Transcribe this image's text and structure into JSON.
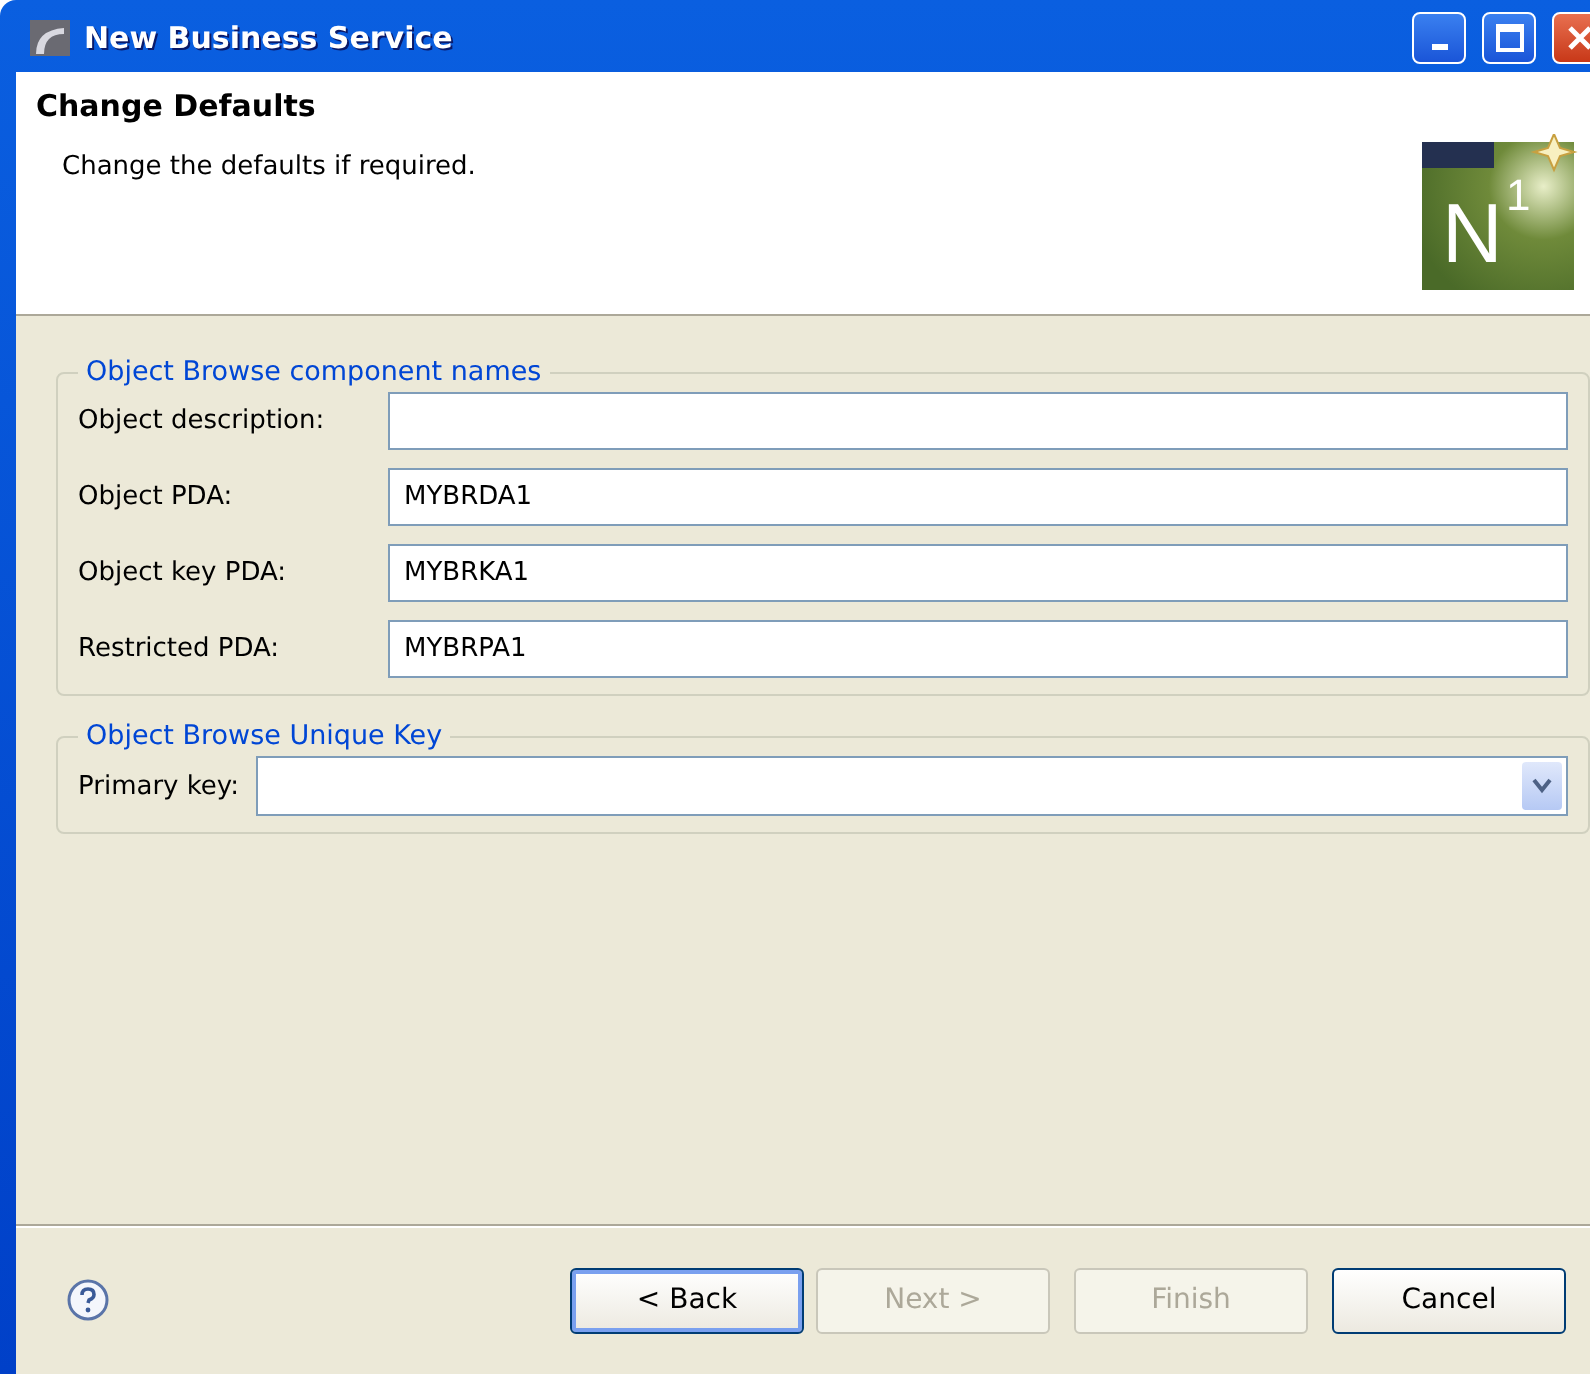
{
  "window": {
    "title": "New Business Service"
  },
  "header": {
    "title": "Change Defaults",
    "description": "Change the defaults if required.",
    "logo": {
      "letter": "N",
      "superscript": "1"
    }
  },
  "groups": [
    {
      "legend": "Object Browse component names",
      "fields": [
        {
          "kind": "text",
          "label": "Object description:"
        },
        {
          "kind": "text",
          "label": "Object PDA:",
          "value": "MYBRDA1"
        },
        {
          "kind": "text",
          "label": "Object key PDA:",
          "value": "MYBRKA1"
        },
        {
          "kind": "text",
          "label": "Restricted PDA:",
          "value": "MYBRPA1"
        }
      ]
    },
    {
      "legend": "Object Browse Unique Key",
      "fields": [
        {
          "kind": "combo",
          "label": "Primary key:"
        }
      ]
    }
  ],
  "buttons": [
    {
      "label": "< Back",
      "disabled": false,
      "default": true
    },
    {
      "label": "Next >",
      "disabled": true,
      "default": false
    },
    {
      "label": "Finish",
      "disabled": true,
      "default": false
    },
    {
      "label": "Cancel",
      "disabled": false,
      "default": false
    }
  ]
}
